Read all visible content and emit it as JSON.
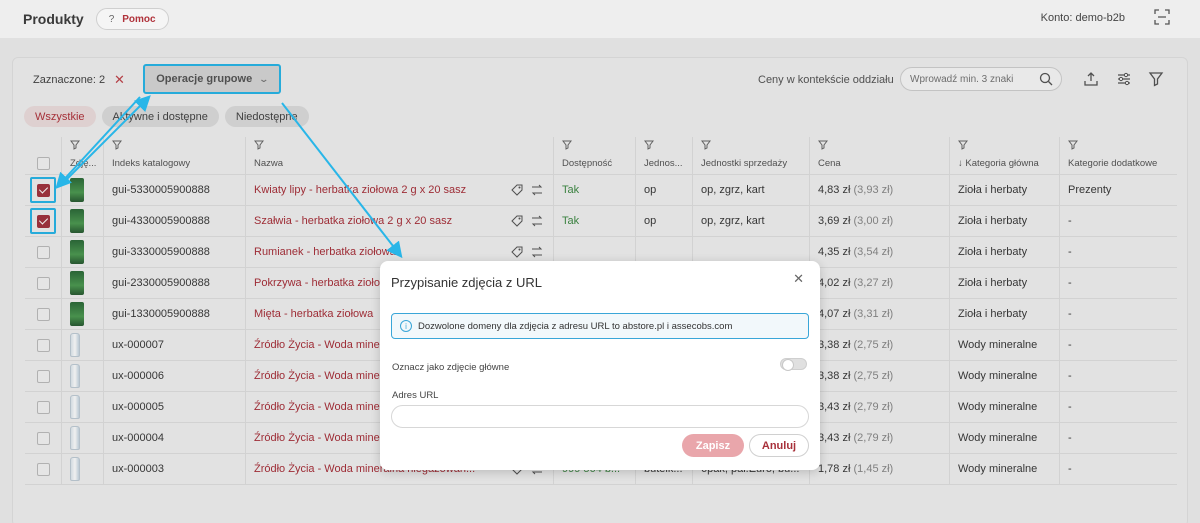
{
  "header": {
    "title": "Produkty",
    "help_label": "Pomoc",
    "help_icon": "?",
    "account": "Konto: demo-b2b"
  },
  "toolbar": {
    "selected_label": "Zaznaczone: 2",
    "clear_symbol": "✕",
    "ops_label": "Operacje grupowe",
    "context_label": "Ceny w kontekście oddziału",
    "search_placeholder": "Wprowadź min. 3 znaki"
  },
  "filters": [
    "Wszystkie",
    "Aktywne i dostępne",
    "Niedostępne"
  ],
  "columns": [
    "Zdję...",
    "Indeks katalogowy",
    "Nazwa",
    "Dostępność",
    "Jednos...",
    "Jednostki sprzedaży",
    "Cena",
    "↓ Kategoria główna",
    "Kategorie dodatkowe"
  ],
  "rows": [
    {
      "checked": true,
      "thumb": "green",
      "index": "gui-5330005900888",
      "name": "Kwiaty lipy - herbatka ziołowa 2 g x 20 sasz",
      "avail": "Tak",
      "unit": "op",
      "sales_units": "op, zgrz, kart",
      "price": "4,83 zł",
      "net": "(3,93 zł)",
      "cat": "Zioła i herbaty",
      "extra": "Prezenty"
    },
    {
      "checked": true,
      "thumb": "green",
      "index": "gui-4330005900888",
      "name": "Szałwia - herbatka ziołowa 2 g x 20 sasz",
      "avail": "Tak",
      "unit": "op",
      "sales_units": "op, zgrz, kart",
      "price": "3,69 zł",
      "net": "(3,00 zł)",
      "cat": "Zioła i herbaty",
      "extra": "-"
    },
    {
      "checked": false,
      "thumb": "green",
      "index": "gui-3330005900888",
      "name": "Rumianek - herbatka ziołowa",
      "avail": "",
      "unit": "",
      "sales_units": "",
      "price": "4,35 zł",
      "net": "(3,54 zł)",
      "cat": "Zioła i herbaty",
      "extra": "-"
    },
    {
      "checked": false,
      "thumb": "green",
      "index": "gui-2330005900888",
      "name": "Pokrzywa - herbatka ziołowa",
      "avail": "",
      "unit": "",
      "sales_units": "",
      "price": "4,02 zł",
      "net": "(3,27 zł)",
      "cat": "Zioła i herbaty",
      "extra": "-"
    },
    {
      "checked": false,
      "thumb": "green",
      "index": "gui-1330005900888",
      "name": "Mięta - herbatka ziołowa",
      "avail": "",
      "unit": "",
      "sales_units": "",
      "price": "4,07 zł",
      "net": "(3,31 zł)",
      "cat": "Zioła i herbaty",
      "extra": "-"
    },
    {
      "checked": false,
      "thumb": "bottle",
      "index": "ux-000007",
      "name": "Źródło Życia - Woda mine",
      "avail": "",
      "unit": "",
      "sales_units": "",
      "price": "3,38 zł",
      "net": "(2,75 zł)",
      "cat": "Wody mineralne",
      "extra": "-"
    },
    {
      "checked": false,
      "thumb": "bottle",
      "index": "ux-000006",
      "name": "Źródło Życia - Woda mine",
      "avail": "",
      "unit": "",
      "sales_units": "",
      "price": "3,38 zł",
      "net": "(2,75 zł)",
      "cat": "Wody mineralne",
      "extra": "-"
    },
    {
      "checked": false,
      "thumb": "bottle",
      "index": "ux-000005",
      "name": "Źródło Życia - Woda mine",
      "avail": "",
      "unit": "",
      "sales_units": "",
      "price": "3,43 zł",
      "net": "(2,79 zł)",
      "cat": "Wody mineralne",
      "extra": "-"
    },
    {
      "checked": false,
      "thumb": "bottle",
      "index": "ux-000004",
      "name": "Źródło Życia - Woda mine",
      "avail": "",
      "unit": "",
      "sales_units": "",
      "price": "3,43 zł",
      "net": "(2,79 zł)",
      "cat": "Wody mineralne",
      "extra": "-"
    },
    {
      "checked": false,
      "thumb": "bottle",
      "index": "ux-000003",
      "name": "Źródło Życia - Woda mineralna niegazowan...",
      "avail": "999 564 b...",
      "unit": "butelk...",
      "sales_units": "6pak, pal.Euro, bu...",
      "price": "1,78 zł",
      "net": "(1,45 zł)",
      "cat": "Wody mineralne",
      "extra": "-"
    }
  ],
  "modal": {
    "title": "Przypisanie zdjęcia z URL",
    "close_symbol": "✕",
    "info_icon": "i",
    "info_text": "Dozwolone domeny dla zdjęcia z adresu URL to abstore.pl i assecobs.com",
    "main_photo_label": "Oznacz jako zdjęcie główne",
    "main_photo_on": false,
    "url_label": "Adres URL",
    "url_value": "",
    "save_label": "Zapisz",
    "cancel_label": "Anuluj"
  },
  "colors": {
    "accent": "#a8303a",
    "highlight": "#29b6e8",
    "available": "#3f8a45"
  }
}
